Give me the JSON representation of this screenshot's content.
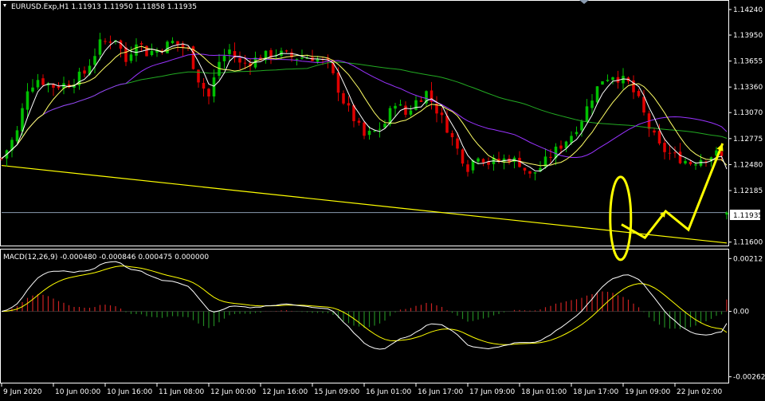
{
  "header": {
    "main_title": "EURUSD.Exp,H1  1.11913 1.11950 1.11858 1.11935",
    "macd_title": "MACD(12,26,9) -0.000480 -0.000846 0.000475 0.000000"
  },
  "colors": {
    "background": "#000000",
    "grid_border": "#ffffff",
    "bull": "#00c000",
    "bear": "#e00000",
    "ma_fast": "#ffffff",
    "ma_mid": "#ffff66",
    "ma_slow_purple": "#9933ff",
    "ma_slow_green": "#22aa22",
    "trendline": "#ffff00",
    "annotation": "#ffff00",
    "bid_line": "#8a9bb0",
    "macd_main": "#ffffff",
    "macd_signal": "#ffff00",
    "hist_pos": "#cc2222",
    "hist_neg": "#228822"
  },
  "current_price_label": "1.11935",
  "chart_data": [
    {
      "type": "candlestick",
      "symbol": "EURUSD.Exp",
      "timeframe": "H1",
      "ohlc_last": {
        "open": 1.11913,
        "high": 1.1195,
        "low": 1.11858,
        "close": 1.11935
      },
      "y_ticks": [
        "1.14240",
        "1.13950",
        "1.13655",
        "1.13360",
        "1.13070",
        "1.12775",
        "1.12480",
        "1.12185",
        "1.11935",
        "1.11600"
      ],
      "y_tick_values": [
        1.1424,
        1.1395,
        1.13655,
        1.1336,
        1.1307,
        1.12775,
        1.1248,
        1.12185,
        1.11935,
        1.116
      ],
      "ylim": [
        1.1157,
        1.1433
      ],
      "x_ticks": [
        "9 Jun 2020",
        "10 Jun 00:00",
        "10 Jun 16:00",
        "11 Jun 08:00",
        "12 Jun 00:00",
        "12 Jun 16:00",
        "15 Jun 09:00",
        "16 Jun 01:00",
        "16 Jun 17:00",
        "17 Jun 09:00",
        "18 Jun 01:00",
        "18 Jun 17:00",
        "19 Jun 09:00",
        "22 Jun 02:00"
      ],
      "xlim": [
        0,
        140
      ],
      "close_path": [
        [
          0,
          1.1255
        ],
        [
          3,
          1.1285
        ],
        [
          5,
          1.1335
        ],
        [
          7,
          1.1345
        ],
        [
          10,
          1.1337
        ],
        [
          13,
          1.134
        ],
        [
          16,
          1.1352
        ],
        [
          19,
          1.1385
        ],
        [
          22,
          1.1392
        ],
        [
          24,
          1.1365
        ],
        [
          26,
          1.139
        ],
        [
          28,
          1.1375
        ],
        [
          30,
          1.1378
        ],
        [
          33,
          1.1387
        ],
        [
          36,
          1.1378
        ],
        [
          38,
          1.1345
        ],
        [
          40,
          1.1325
        ],
        [
          42,
          1.1365
        ],
        [
          44,
          1.1378
        ],
        [
          46,
          1.1362
        ],
        [
          48,
          1.1365
        ],
        [
          50,
          1.137
        ],
        [
          53,
          1.1375
        ],
        [
          56,
          1.137
        ],
        [
          60,
          1.137
        ],
        [
          63,
          1.1362
        ],
        [
          66,
          1.132
        ],
        [
          68,
          1.13
        ],
        [
          70,
          1.128
        ],
        [
          72,
          1.1285
        ],
        [
          74,
          1.1295
        ],
        [
          76,
          1.132
        ],
        [
          78,
          1.1305
        ],
        [
          80,
          1.132
        ],
        [
          82,
          1.133
        ],
        [
          84,
          1.131
        ],
        [
          86,
          1.129
        ],
        [
          88,
          1.1265
        ],
        [
          90,
          1.1245
        ],
        [
          92,
          1.126
        ],
        [
          94,
          1.125
        ],
        [
          96,
          1.1252
        ],
        [
          98,
          1.1255
        ],
        [
          100,
          1.125
        ],
        [
          102,
          1.1235
        ],
        [
          104,
          1.1245
        ],
        [
          106,
          1.1258
        ],
        [
          108,
          1.127
        ],
        [
          110,
          1.1282
        ],
        [
          112,
          1.13
        ],
        [
          114,
          1.1325
        ],
        [
          116,
          1.1345
        ],
        [
          118,
          1.135
        ],
        [
          121,
          1.134
        ],
        [
          123,
          1.132
        ],
        [
          125,
          1.129
        ],
        [
          127,
          1.1268
        ],
        [
          129,
          1.126
        ],
        [
          131,
          1.1255
        ],
        [
          133,
          1.125
        ],
        [
          135,
          1.1255
        ],
        [
          138,
          1.126
        ],
        [
          140,
          1.1252
        ]
      ]
    },
    {
      "type": "bar",
      "name": "MACD(12,26,9)",
      "values_last": {
        "main": -0.00048,
        "signal": -0.000846,
        "histogram": 0.000475
      },
      "y_ticks": [
        "0.00212",
        "0.00",
        "-0.002626"
      ],
      "y_tick_values": [
        0.00212,
        0.0,
        -0.002626
      ],
      "ylim": [
        -0.00283,
        0.00245
      ]
    }
  ]
}
